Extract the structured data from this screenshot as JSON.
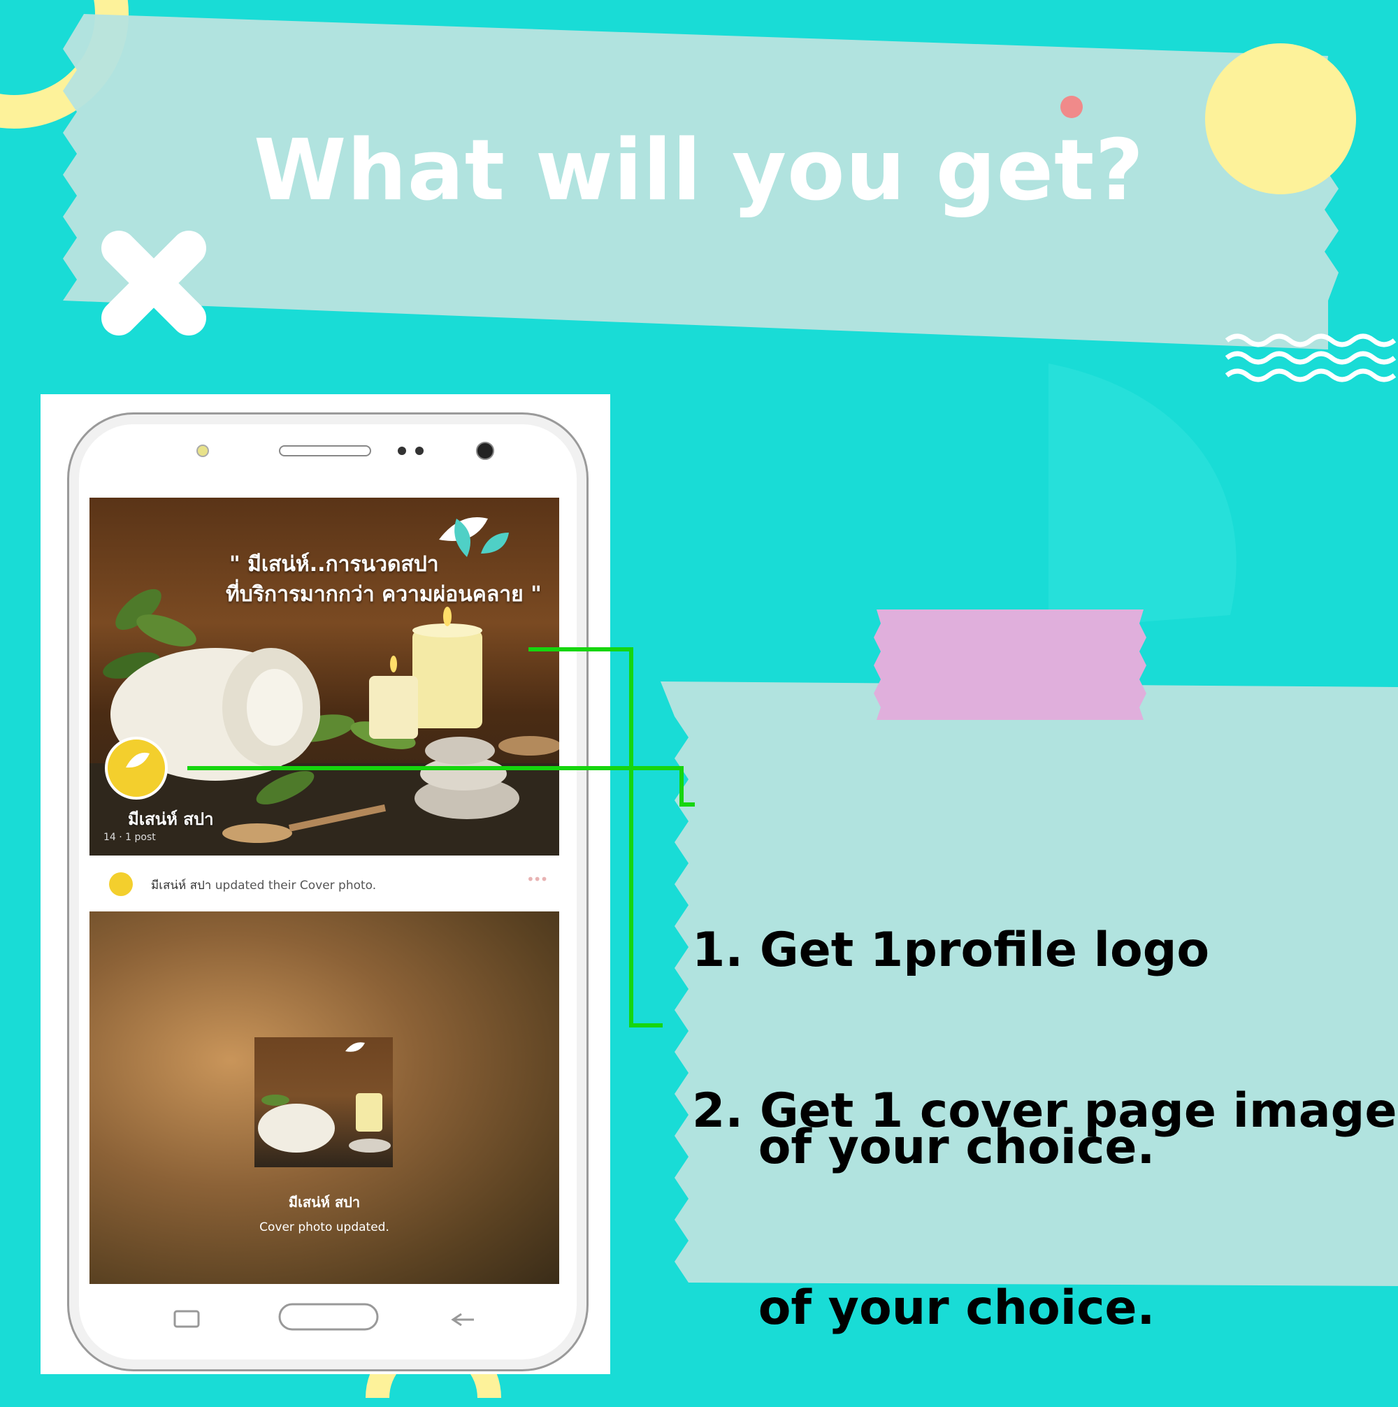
{
  "title": "What will you get?",
  "items": [
    {
      "line1": "1. Get 1profile logo",
      "line2": "    of your choice."
    },
    {
      "line1": "2. Get 1 cover page image",
      "line2": "    of your choice."
    }
  ],
  "phone": {
    "cover_slogan_line1": "\" มีเสน่ห์..การนวดสปา",
    "cover_slogan_line2": "ที่บริการมากกว่า ความผ่อนคลาย \"",
    "page_name": "มีเสน่ห์ สปา",
    "page_stats": "14 · 1 post",
    "update_name": "มีเสน่ห์ สปา",
    "update_text": " updated their Cover photo.",
    "post_name": "มีเสน่ห์ สปา",
    "post_caption": "Cover photo updated."
  },
  "colors": {
    "background": "#19dcd6",
    "banner": "#b3e4e0",
    "tape": "#e0afdc",
    "accent_line": "#16d60e",
    "deco_yellow": "#fdf29a",
    "deco_dot": "#f08a8a"
  }
}
